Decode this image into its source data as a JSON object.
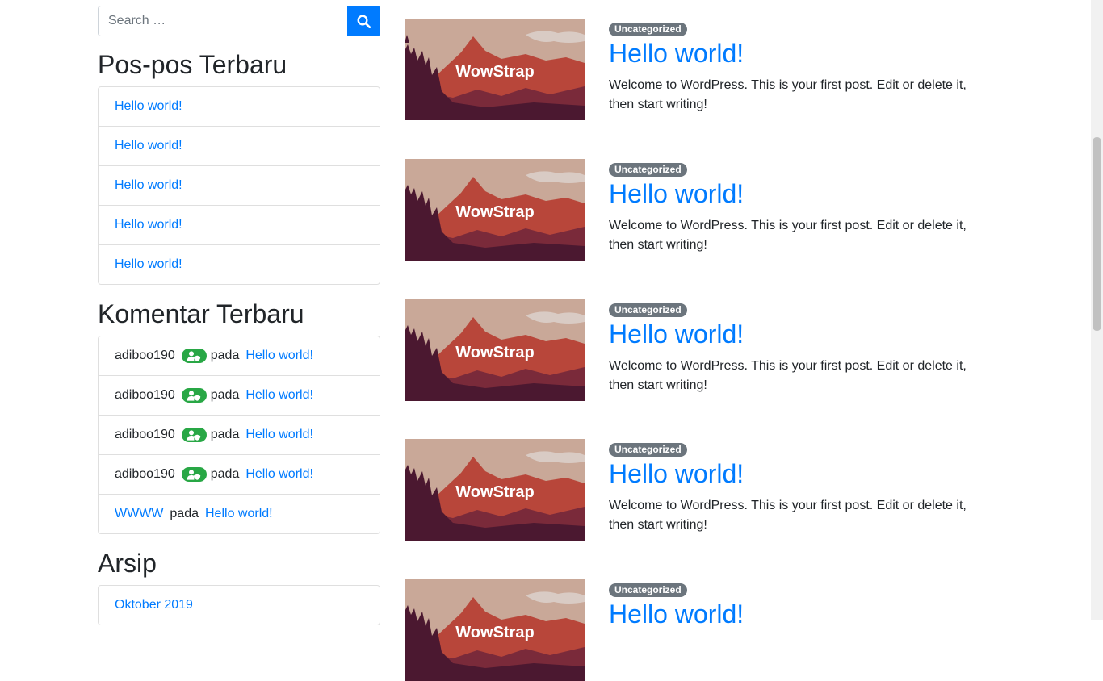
{
  "search": {
    "placeholder": "Search …",
    "icon": "search-icon"
  },
  "recent_posts": {
    "title": "Pos-pos Terbaru",
    "items": [
      {
        "label": "Hello world!"
      },
      {
        "label": "Hello world!"
      },
      {
        "label": "Hello world!"
      },
      {
        "label": "Hello world!"
      },
      {
        "label": "Hello world!"
      }
    ]
  },
  "recent_comments": {
    "title": "Komentar Terbaru",
    "items": [
      {
        "author": "adiboo190",
        "badge_icon": "user-shield-icon",
        "on": "pada",
        "post": "Hello world!"
      },
      {
        "author": "adiboo190",
        "badge_icon": "user-shield-icon",
        "on": "pada",
        "post": "Hello world!"
      },
      {
        "author": "adiboo190",
        "badge_icon": "user-shield-icon",
        "on": "pada",
        "post": "Hello world!"
      },
      {
        "author": "adiboo190",
        "badge_icon": "user-shield-icon",
        "on": "pada",
        "post": "Hello world!"
      },
      {
        "author": "WWWW",
        "on": "pada",
        "post": "Hello world!"
      }
    ]
  },
  "archives": {
    "title": "Arsip",
    "items": [
      {
        "label": "Oktober 2019"
      }
    ]
  },
  "posts": [
    {
      "thumb_text": "WowStrap",
      "category": "Uncategorized",
      "title": "Hello world!",
      "excerpt": "Welcome to WordPress. This is your first post. Edit or delete it, then start writing!"
    },
    {
      "thumb_text": "WowStrap",
      "category": "Uncategorized",
      "title": "Hello world!",
      "excerpt": "Welcome to WordPress. This is your first post. Edit or delete it, then start writing!"
    },
    {
      "thumb_text": "WowStrap",
      "category": "Uncategorized",
      "title": "Hello world!",
      "excerpt": "Welcome to WordPress. This is your first post. Edit or delete it, then start writing!"
    },
    {
      "thumb_text": "WowStrap",
      "category": "Uncategorized",
      "title": "Hello world!",
      "excerpt": "Welcome to WordPress. This is your first post. Edit or delete it, then start writing!"
    },
    {
      "thumb_text": "WowStrap",
      "category": "Uncategorized",
      "title": "Hello world!"
    }
  ],
  "colors": {
    "link": "#007bff",
    "primary": "#007bff",
    "badge_secondary": "#6c757d",
    "badge_success": "#28a745",
    "thumb_sky": "#c9a898",
    "thumb_mountain": "#b8463a",
    "thumb_forest": "#4b1830"
  }
}
